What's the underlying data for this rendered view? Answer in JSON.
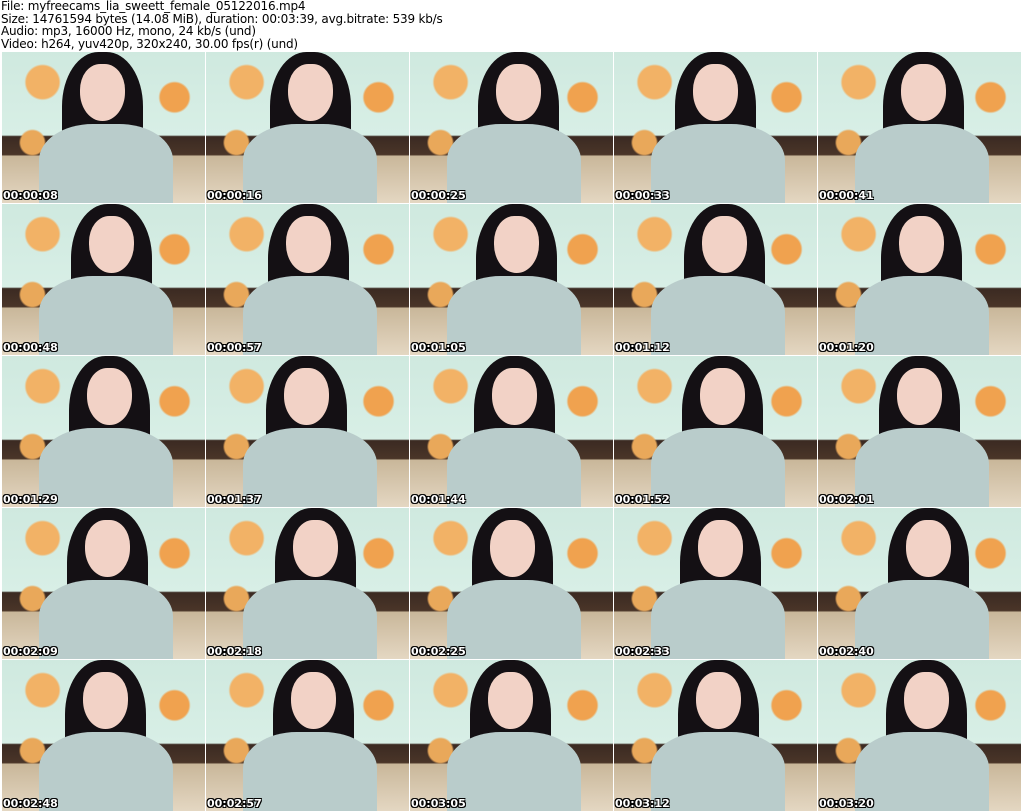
{
  "header": {
    "file": "File: myfreecams_lia_sweett_female_05122016.mp4",
    "size": "Size: 14761594 bytes (14.08 MiB), duration: 00:03:39, avg.bitrate: 539 kb/s",
    "audio": "Audio: mp3, 16000 Hz, mono, 24 kb/s (und)",
    "video": "Video: h264, yuv420p, 320x240, 30.00 fps(r) (und)"
  },
  "thumbnails": [
    "00:00:08",
    "00:00:16",
    "00:00:25",
    "00:00:33",
    "00:00:41",
    "00:00:48",
    "00:00:57",
    "00:01:05",
    "00:01:12",
    "00:01:20",
    "00:01:29",
    "00:01:37",
    "00:01:44",
    "00:01:52",
    "00:02:01",
    "00:02:09",
    "00:02:18",
    "00:02:25",
    "00:02:33",
    "00:02:40",
    "00:02:48",
    "00:02:57",
    "00:03:05",
    "00:03:12",
    "00:03:20"
  ]
}
